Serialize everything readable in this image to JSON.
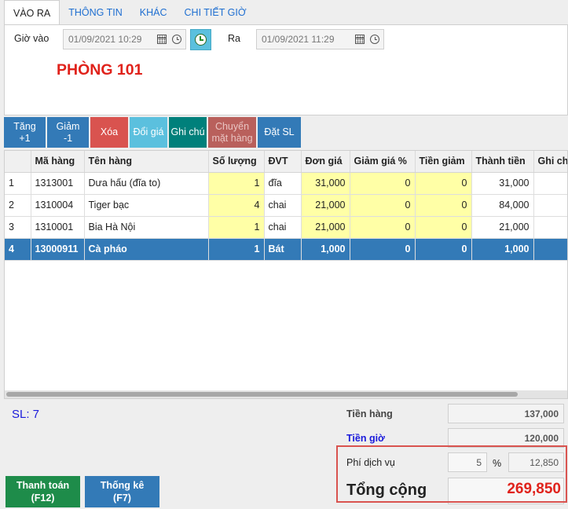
{
  "tabs": [
    "VÀO RA",
    "THÔNG TIN",
    "KHÁC",
    "CHI TIẾT GIỜ"
  ],
  "checkin": {
    "label": "Giờ vào",
    "value": "01/09/2021 10:29",
    "out_label": "Ra",
    "out_value": "01/09/2021 11:29"
  },
  "room": "PHÒNG 101",
  "actions": {
    "inc_line1": "Tăng",
    "inc_line2": "+1",
    "dec_line1": "Giảm",
    "dec_line2": "-1",
    "delete": "Xóa",
    "change_price": "Đổi giá",
    "note": "Ghi chú",
    "move_line1": "Chuyển",
    "move_line2": "mặt hàng",
    "set_qty": "Đặt SL"
  },
  "table": {
    "headers": [
      "",
      "Mã hàng",
      "Tên hàng",
      "Số lượng",
      "ĐVT",
      "Đơn giá",
      "Giảm giá %",
      "Tiền giảm",
      "Thành tiền",
      "Ghi chú"
    ],
    "rows": [
      [
        "1",
        "1313001",
        "Dưa hấu (đĩa to)",
        "1",
        "đĩa",
        "31,000",
        "0",
        "0",
        "31,000",
        ""
      ],
      [
        "2",
        "1310004",
        "Tiger bạc",
        "4",
        "chai",
        "21,000",
        "0",
        "0",
        "84,000",
        ""
      ],
      [
        "3",
        "1310001",
        "Bia Hà Nội",
        "1",
        "chai",
        "21,000",
        "0",
        "0",
        "21,000",
        ""
      ],
      [
        "4",
        "13000911",
        "Cà pháo",
        "1",
        "Bát",
        "1,000",
        "0",
        "0",
        "1,000",
        ""
      ]
    ]
  },
  "footer": {
    "sl": "SL: 7",
    "tien_hang_label": "Tiền hàng",
    "tien_hang": "137,000",
    "tien_gio_label": "Tiền giờ",
    "tien_gio": "120,000",
    "phi_dich_vu_label": "Phí dịch vụ",
    "phi_dich_vu_pct": "5",
    "pct_sign": "%",
    "phi_dich_vu": "12,850",
    "total_label": "Tổng cộng",
    "total": "269,850",
    "pay_line1": "Thanh toán",
    "pay_line2": "(F12)",
    "stats_line1": "Thống kê",
    "stats_line2": "(F7)"
  },
  "colors": {
    "accent_blue": "#337ab7",
    "total_red": "#e0221b",
    "pay_green": "#1e8c4a",
    "highlight": "#d9534f"
  }
}
